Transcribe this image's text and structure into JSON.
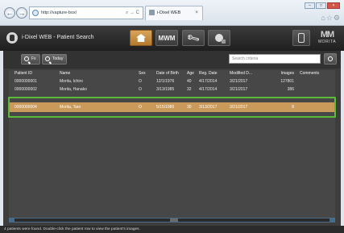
{
  "browser": {
    "url": "http://vapture-box/",
    "address_tools": "⌕ → C",
    "tab_title": "i-Dixel WEB",
    "tab_close": "×",
    "back_icon": "←",
    "forward_icon": "→",
    "win_min": "–",
    "win_max": "□",
    "win_close": "×",
    "right_icons": "⌂☆⚙"
  },
  "header": {
    "title": "i-Dixel WEB - Patient Search",
    "mwm_label": "MWM",
    "brand_mark": "MM",
    "brand_word": "MORITA"
  },
  "toolbar": {
    "fx_label": "Fx",
    "today_label": "Today",
    "search_placeholder": "Search criteria"
  },
  "table": {
    "columns": [
      "Patient ID",
      "Name",
      "Sex",
      "Date of Birth",
      "Age",
      "Reg. Date",
      "Modified D...",
      "Images",
      "Comments"
    ],
    "rows": [
      {
        "id": "0000000001",
        "name": "Morita, Ichiro",
        "sex": "O",
        "dob": "12/1/1976",
        "age": "40",
        "reg": "4/17/2014",
        "mod": "3/21/2017",
        "images": "127801",
        "comments": ""
      },
      {
        "id": "0000000002",
        "name": "Morita, Hanako",
        "sex": "O",
        "dob": "3/13/1985",
        "age": "32",
        "reg": "4/17/2014",
        "mod": "3/21/2017",
        "images": "386",
        "comments": ""
      },
      {
        "id": "0000000004",
        "name": "Morita, Taro",
        "sex": "O",
        "dob": "5/15/1986",
        "age": "30",
        "reg": "3/13/2017",
        "mod": "3/21/2017",
        "images": "8",
        "comments": ""
      }
    ]
  },
  "status": {
    "text": "4 patients were found. Double-click the patient row to view the patient's images."
  },
  "colors": {
    "selected_row": "#c99a5a",
    "highlight_outline": "#5dbb3a",
    "header_bg": "#2b2b2b"
  }
}
